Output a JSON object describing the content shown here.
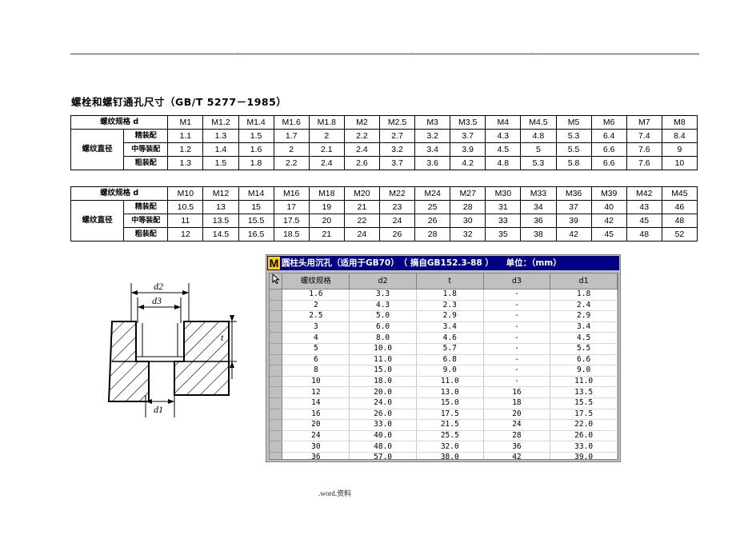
{
  "header": {
    "dots": [
      ".",
      ".",
      ".",
      "."
    ]
  },
  "title": "螺栓和螺钉通孔尺寸（GB/T 5277－1985）",
  "table1": {
    "spec_label": "螺纹规格 d",
    "group_label": "螺纹直径",
    "sizes": [
      "M1",
      "M1.2",
      "M1.4",
      "M1.6",
      "M1.8",
      "M2",
      "M2.5",
      "M3",
      "M3.5",
      "M4",
      "M4.5",
      "M5",
      "M6",
      "M7",
      "M8"
    ],
    "rows": [
      {
        "label": "精装配",
        "values": [
          "1.1",
          "1.3",
          "1.5",
          "1.7",
          "2",
          "2.2",
          "2.7",
          "3.2",
          "3.7",
          "4.3",
          "4.8",
          "5.3",
          "6.4",
          "7.4",
          "8.4"
        ]
      },
      {
        "label": "中等装配",
        "values": [
          "1.2",
          "1.4",
          "1.6",
          "2",
          "2.1",
          "2.4",
          "3.2",
          "3.4",
          "3.9",
          "4.5",
          "5",
          "5.5",
          "6.6",
          "7.6",
          "9"
        ]
      },
      {
        "label": "粗装配",
        "values": [
          "1.3",
          "1.5",
          "1.8",
          "2.2",
          "2.4",
          "2.6",
          "3.7",
          "3.6",
          "4.2",
          "4.8",
          "5.3",
          "5.8",
          "6.6",
          "7.6",
          "10"
        ]
      }
    ]
  },
  "table2": {
    "spec_label": "螺纹规格 d",
    "group_label": "螺纹直径",
    "sizes": [
      "M10",
      "M12",
      "M14",
      "M16",
      "M18",
      "M20",
      "M22",
      "M24",
      "M27",
      "M30",
      "M33",
      "M36",
      "M39",
      "M42",
      "M45"
    ],
    "rows": [
      {
        "label": "精装配",
        "values": [
          "10.5",
          "13",
          "15",
          "17",
          "19",
          "21",
          "23",
          "25",
          "28",
          "31",
          "34",
          "37",
          "40",
          "43",
          "46"
        ]
      },
      {
        "label": "中等装配",
        "values": [
          "11",
          "13.5",
          "15.5",
          "17.5",
          "20",
          "22",
          "24",
          "26",
          "30",
          "33",
          "36",
          "39",
          "42",
          "45",
          "48"
        ]
      },
      {
        "label": "粗装配",
        "values": [
          "12",
          "14.5",
          "16.5",
          "18.5",
          "21",
          "24",
          "26",
          "28",
          "32",
          "35",
          "38",
          "42",
          "45",
          "48",
          "52"
        ]
      }
    ]
  },
  "drawing": {
    "labels": {
      "d2": "d2",
      "d3": "d3",
      "d1": "d1",
      "t": "t"
    }
  },
  "window": {
    "icon": "M",
    "title": "圆柱头用沉孔（适用于GB70）　（ 摘自GB152.3-88 ）　　单位：（mm）",
    "columns": [
      "螺纹规格",
      "d2",
      "t",
      "d3",
      "d1"
    ],
    "rows": [
      [
        "1.6",
        "3.3",
        "1.8",
        "-",
        "1.8"
      ],
      [
        "2",
        "4.3",
        "2.3",
        "-",
        "2.4"
      ],
      [
        "2.5",
        "5.0",
        "2.9",
        "-",
        "2.9"
      ],
      [
        "3",
        "6.0",
        "3.4",
        "-",
        "3.4"
      ],
      [
        "4",
        "8.0",
        "4.6",
        "-",
        "4.5"
      ],
      [
        "5",
        "10.0",
        "5.7",
        "-",
        "5.5"
      ],
      [
        "6",
        "11.0",
        "6.8",
        "-",
        "6.6"
      ],
      [
        "8",
        "15.0",
        "9.0",
        "-",
        "9.0"
      ],
      [
        "10",
        "18.0",
        "11.0",
        "-",
        "11.0"
      ],
      [
        "12",
        "20.0",
        "13.0",
        "16",
        "13.5"
      ],
      [
        "14",
        "24.0",
        "15.0",
        "18",
        "15.5"
      ],
      [
        "16",
        "26.0",
        "17.5",
        "20",
        "17.5"
      ],
      [
        "20",
        "33.0",
        "21.5",
        "24",
        "22.0"
      ],
      [
        "24",
        "40.0",
        "25.5",
        "28",
        "26.0"
      ],
      [
        "30",
        "48.0",
        "32.0",
        "36",
        "33.0"
      ],
      [
        "36",
        "57.0",
        "38.0",
        "42",
        "39.0"
      ]
    ]
  },
  "footer": {
    "text": ".word.资料"
  }
}
